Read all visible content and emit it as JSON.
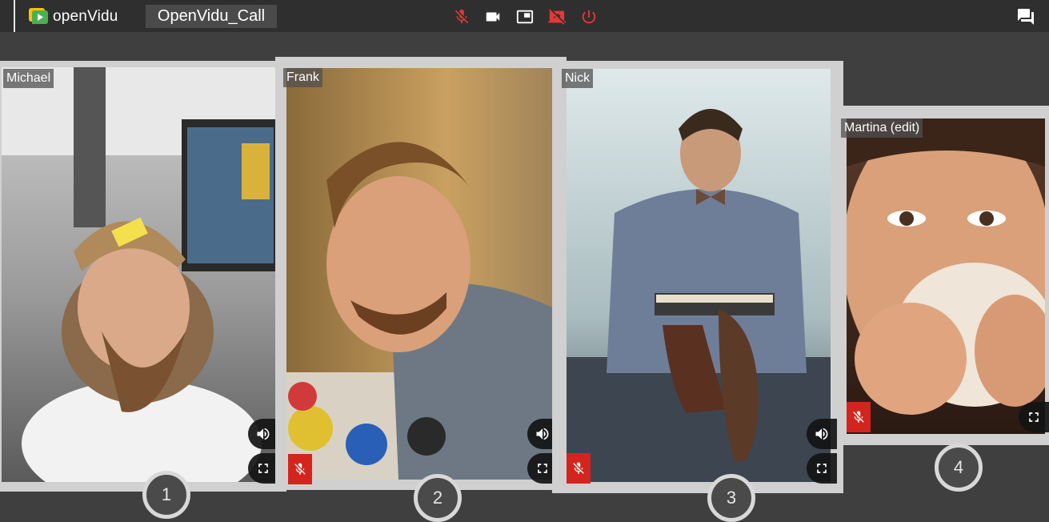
{
  "app": {
    "brand": "openVidu",
    "session_name": "OpenVidu_Call"
  },
  "toolbar": {
    "mic_icon": "mic-off-icon",
    "camera_icon": "videocam-icon",
    "pip_icon": "picture-in-picture-icon",
    "screen_icon": "screen-share-off-icon",
    "leave_icon": "power-icon",
    "chat_icon": "chat-icon"
  },
  "colors": {
    "topbar": "#2f2f2f",
    "background": "#3f3f3f",
    "accent_red": "#e53935",
    "mute_badge": "#d3251d",
    "frame": "#d0d0d0"
  },
  "participants": [
    {
      "name": "Michael",
      "number": "1",
      "muted": false
    },
    {
      "name": "Frank",
      "number": "2",
      "muted": true
    },
    {
      "name": "Nick",
      "number": "3",
      "muted": true
    },
    {
      "name": "Martina (edit)",
      "number": "4",
      "muted": true
    }
  ]
}
